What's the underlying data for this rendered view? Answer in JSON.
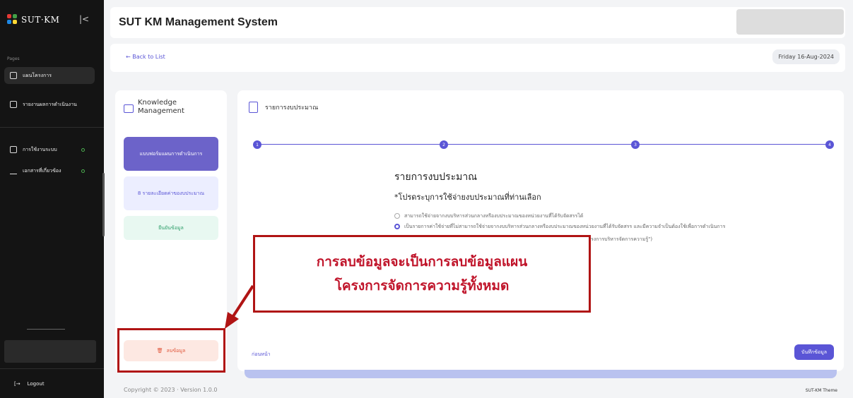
{
  "sidebar": {
    "logo_text": "SUT·KM",
    "collapse_icon": "collapse-left-icon",
    "section_label": "Pages",
    "items": [
      {
        "label": "แผนโครงการ",
        "icon": "grid-icon"
      },
      {
        "label": "รายงานผลการดำเนินงาน",
        "icon": "report-icon"
      },
      {
        "label": "การใช้งานระบบ",
        "icon": "grid-icon"
      },
      {
        "label": "เอกสารที่เกี่ยวข้อง",
        "icon": "download-icon"
      }
    ],
    "logout": "Logout"
  },
  "header": {
    "title": "SUT KM Management System"
  },
  "subbar": {
    "back": "← Back to List",
    "date": "Friday 16-Aug-2024"
  },
  "left_panel": {
    "title": "Knowledge Management",
    "steps": [
      "แบบฟอร์มแผนการดำเนินการ",
      "8 รายละเอียดค่าของบประมาณ",
      "ยืนยันข้อมูล"
    ],
    "delete": "ลบข้อมูล"
  },
  "main": {
    "title": "รายการงบประมาณ",
    "step_numbers": [
      "1",
      "2",
      "3",
      "4"
    ],
    "form_heading": "รายการงบประมาณ",
    "form_sub": "*โปรดระบุการใช้จ่ายงบประมาณที่ท่านเลือก",
    "options": [
      "สามารถใช้จ่ายจากงบบริหารส่วนกลางหรืองบประมาณของหน่วยงานที่ได้รับจัดสรรได้",
      "เป็นรายการค่าใช้จ่ายที่ไม่สามารถใช้จ่ายจากงบบริหารส่วนกลางหรืองบประมาณของหน่วยงานที่ได้รับจัดสรร และมีความจำเป็นต้องใช้เพื่อการดำเนินการ",
      "รงการบริหารจัดการความรู้\")"
    ],
    "prev": "ก่อนหน้า",
    "save": "บันทึกข้อมูล"
  },
  "footer": {
    "copyright": "Copyright © 2023 · Version 1.0.0",
    "theme": "SUT-KM Theme"
  },
  "annotation": {
    "line1": "การลบข้อมูลจะเป็นการลบข้อมูลแผน",
    "line2": "โครงการจัดการความรู้ทั้งหมด",
    "color": "#c0142a"
  }
}
